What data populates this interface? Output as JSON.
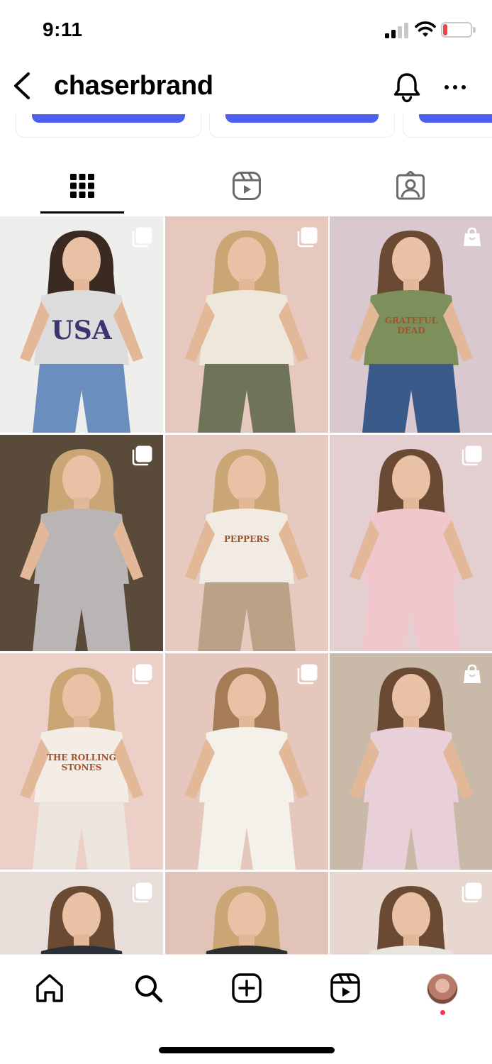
{
  "status_bar": {
    "time": "9:11",
    "battery_level": "16",
    "battery_fraction": 0.16,
    "battery_color": "#e24a4a"
  },
  "header": {
    "title": "chaserbrand",
    "back_icon": "chevron-left-icon",
    "bell_icon": "bell-icon",
    "more_icon": "more-horizontal-icon"
  },
  "accent_color": "#4c5fef",
  "tabs": [
    {
      "name": "posts",
      "icon": "grid-icon",
      "selected": true
    },
    {
      "name": "reels",
      "icon": "reels-icon",
      "selected": false
    },
    {
      "name": "tagged",
      "icon": "tagged-user-icon",
      "selected": false
    }
  ],
  "grid": {
    "posts": [
      {
        "badge": "carousel-icon",
        "palette": "#eeeeec",
        "shirt": "#dcdcdc",
        "pants": "#6a8fbf",
        "hair": "#3b2a22",
        "graphic": "USA"
      },
      {
        "badge": "carousel-icon",
        "palette": "#e7c8bf",
        "shirt": "#efe7da",
        "pants": "#6f7458",
        "hair": "#c9a673",
        "graphic": ""
      },
      {
        "badge": "shopping-bag-icon",
        "palette": "#d9c8d0",
        "shirt": "#7d8f5a",
        "pants": "#3a5a8a",
        "hair": "#6a4a33",
        "graphic": "GRATEFUL DEAD"
      },
      {
        "badge": "carousel-icon",
        "palette": "#5a4a3a",
        "shirt": "#b9b5b5",
        "pants": "#b9b5b5",
        "hair": "#c9a673",
        "graphic": ""
      },
      {
        "badge": "",
        "palette": "#e6c9bf",
        "shirt": "#f2ebe3",
        "pants": "#b9a286",
        "hair": "#c9a673",
        "graphic": "PEPPERS"
      },
      {
        "badge": "carousel-icon",
        "palette": "#e3cfcf",
        "shirt": "#efc7cd",
        "pants": "#efc7cd",
        "hair": "#6a4a33",
        "graphic": ""
      },
      {
        "badge": "carousel-icon",
        "palette": "#ecd0c8",
        "shirt": "#f4ede6",
        "pants": "#ece6df",
        "hair": "#c9a673",
        "graphic": "THE ROLLING STONES"
      },
      {
        "badge": "carousel-icon",
        "palette": "#e5c7bd",
        "shirt": "#f4f0ea",
        "pants": "#f4f0ea",
        "hair": "#a57c55",
        "graphic": ""
      },
      {
        "badge": "shopping-bag-icon",
        "palette": "#c9b9a8",
        "shirt": "#e9cfd8",
        "pants": "#e9cfd8",
        "hair": "#6a4a33",
        "graphic": ""
      },
      {
        "badge": "carousel-icon",
        "palette": "#e8ddd8",
        "shirt": "#2a2f3a",
        "pants": "#2a2f3a",
        "hair": "#6a4a33",
        "graphic": ""
      },
      {
        "badge": "",
        "palette": "#e2c3b8",
        "shirt": "#2f2f2f",
        "pants": "#2f2f2f",
        "hair": "#c9a673",
        "graphic": ""
      },
      {
        "badge": "carousel-icon",
        "palette": "#e8d7cf",
        "shirt": "#e9e4de",
        "pants": "#e9e4de",
        "hair": "#6a4a33",
        "graphic": ""
      }
    ]
  },
  "bottom_nav": [
    {
      "name": "home",
      "icon": "home-icon"
    },
    {
      "name": "search",
      "icon": "search-icon"
    },
    {
      "name": "create",
      "icon": "plus-square-icon"
    },
    {
      "name": "reels",
      "icon": "reels-icon"
    },
    {
      "name": "profile",
      "icon": "avatar"
    }
  ]
}
